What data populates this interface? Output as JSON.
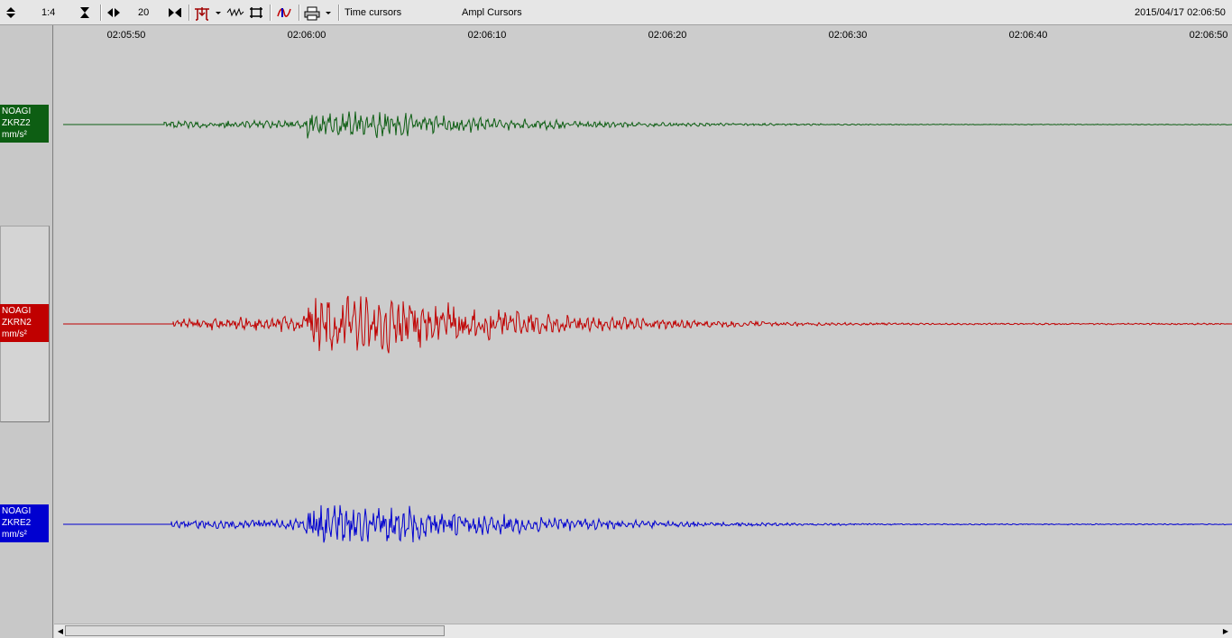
{
  "toolbar": {
    "zoom_ratio": "1:4",
    "step_value": "20",
    "time_cursors_label": "Time cursors",
    "ampl_cursors_label": "Ampl Cursors",
    "datetime": "2015/04/17 02:06:50"
  },
  "time_axis": {
    "ticks": [
      "02:05:50",
      "02:06:00",
      "02:06:10",
      "02:06:20",
      "02:06:30",
      "02:06:40",
      "02:06:50"
    ]
  },
  "channels": [
    {
      "station": "NOAGI",
      "component": "ZKRZ2",
      "unit": "mm/s²",
      "color": "#0d5e13"
    },
    {
      "station": "NOAGI",
      "component": "ZKRN2",
      "unit": "mm/s²",
      "color": "#c00000"
    },
    {
      "station": "NOAGI",
      "component": "ZKRE2",
      "unit": "mm/s²",
      "color": "#0000d0"
    }
  ],
  "colors": {
    "background": "#cccccc",
    "toolbar": "#e6e6e6"
  }
}
